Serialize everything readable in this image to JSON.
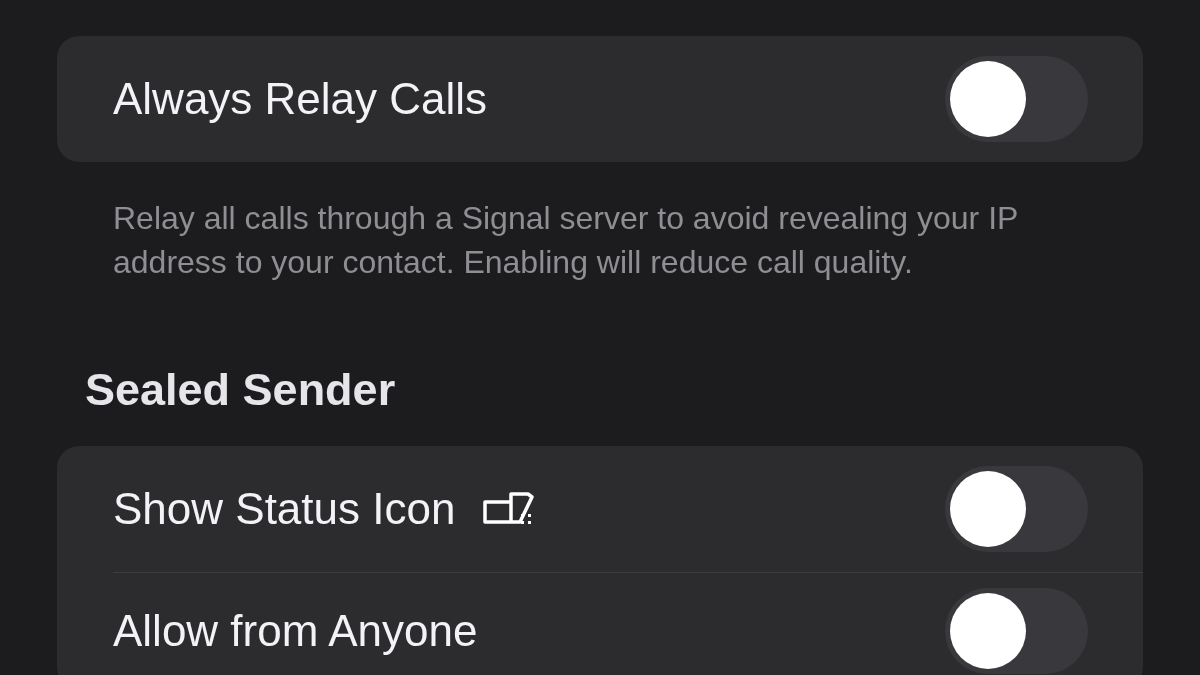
{
  "sections": [
    {
      "rows": [
        {
          "kind": "toggle",
          "label": "Always Relay Calls",
          "on": false
        }
      ],
      "footer": "Relay all calls through a Signal server to avoid revealing your IP address to your contact. Enabling will reduce call quality."
    },
    {
      "header": "Sealed Sender",
      "rows": [
        {
          "kind": "toggle_with_icon",
          "label": "Show Status Icon",
          "on": false
        },
        {
          "kind": "toggle",
          "label": "Allow from Anyone",
          "on": false
        }
      ]
    }
  ]
}
